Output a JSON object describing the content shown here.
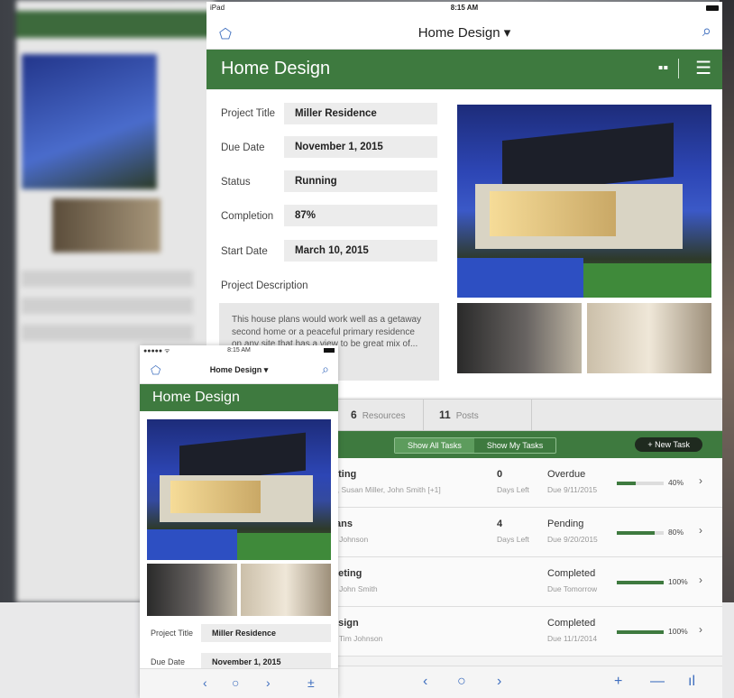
{
  "ipad": {
    "status": {
      "device": "iPad",
      "time": "8:15 AM"
    },
    "nav_title": "Home Design ▾",
    "header_title": "Home Design",
    "fields": [
      {
        "label": "Project Title",
        "value": "Miller Residence"
      },
      {
        "label": "Due Date",
        "value": "November 1, 2015"
      },
      {
        "label": "Status",
        "value": "Running"
      },
      {
        "label": "Completion",
        "value": "87%"
      },
      {
        "label": "Start Date",
        "value": "March 10, 2015"
      }
    ],
    "description_label": "Project Description",
    "description": "This house plans would work well as a getaway second home or a peaceful primary residence on any site that has a view to be great mix of...",
    "counts": [
      {
        "num": "6",
        "label": "Resources"
      },
      {
        "num": "11",
        "label": "Posts"
      }
    ],
    "segment": {
      "all": "Show All Tasks",
      "mine": "Show My Tasks"
    },
    "new_task": "+ New Task",
    "tasks": [
      {
        "name": "eting",
        "people": "n, Susan Miller, John Smith [+1]",
        "days": "0",
        "days_label": "Days Left",
        "status": "Overdue",
        "due": "Due 9/11/2015",
        "percent_label": "40%",
        "progress": 0.4
      },
      {
        "name": "lans",
        "people": "n Johnson",
        "days": "4",
        "days_label": "Days Left",
        "status": "Pending",
        "due": "Due 9/20/2015",
        "percent_label": "80%",
        "progress": 0.8
      },
      {
        "name": "eeting",
        "people": "r, John Smith",
        "days": "",
        "days_label": "",
        "status": "Completed",
        "due": "Due Tomorrow",
        "percent_label": "100%",
        "progress": 1.0
      },
      {
        "name": "esign",
        "people": "r, Tim Johnson",
        "days": "",
        "days_label": "",
        "status": "Completed",
        "due": "Due 11/1/2014",
        "percent_label": "100%",
        "progress": 1.0
      }
    ]
  },
  "iphone": {
    "status": {
      "carrier": "●●●●● ᯤ",
      "time": "8:15 AM"
    },
    "nav_title": "Home Design ▾",
    "header_title": "Home Design",
    "fields": [
      {
        "label": "Project Title",
        "value": "Miller Residence"
      },
      {
        "label": "Due Date",
        "value": "November 1, 2015"
      }
    ]
  },
  "colors": {
    "accent_green": "#3e7a3f",
    "link_blue": "#3f6fbf"
  },
  "icons": [
    "logo-icon",
    "search-icon",
    "grid-icon",
    "menu-icon",
    "back-icon",
    "circle-icon",
    "forward-icon",
    "add-icon",
    "minus-icon",
    "stats-icon",
    "chevron-right-icon"
  ]
}
